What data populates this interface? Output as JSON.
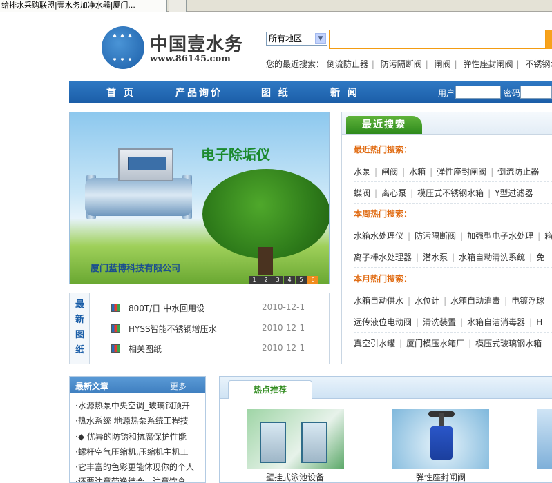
{
  "browser": {
    "tab_title": "给排水采购联盟|壹水务加净水器|厦门..."
  },
  "header": {
    "logo_text": "中国壹水务",
    "logo_url": "www.86145.com",
    "region_select": "所有地区",
    "search_placeholder": "",
    "recent_label": "您的最近搜索：",
    "recent_terms": [
      "倒流防止器",
      "防污隔断阀",
      "闸阀",
      "弹性座封闸阀",
      "不锈钢水箱"
    ]
  },
  "nav": {
    "items": [
      "首 页",
      "产品询价",
      "图 纸",
      "新 闻"
    ],
    "user_label": "用户",
    "password_label": "密码"
  },
  "banner": {
    "title": "电子除垢仪",
    "company": "厦门蓝博科技有限公司",
    "pager": [
      "1",
      "2",
      "3",
      "4",
      "5",
      "6"
    ]
  },
  "drawings": {
    "label_chars": [
      "最",
      "新",
      "图",
      "纸"
    ],
    "rows": [
      {
        "title": "800T/日 中水回用设",
        "date": "2010-12-1"
      },
      {
        "title": "HYSS智能不锈钢增压水",
        "date": "2010-12-1"
      },
      {
        "title": "相关图纸",
        "date": "2010-12-1"
      }
    ]
  },
  "recent_panel": {
    "tab": "最近搜索",
    "sections": [
      {
        "title": "最近热门搜索：",
        "lines": [
          [
            "水泵",
            "闸阀",
            "水箱",
            "弹性座封闸阀",
            "倒流防止器"
          ],
          [
            "蝶阀",
            "离心泵",
            "模压式不锈钢水箱",
            "Y型过滤器"
          ]
        ]
      },
      {
        "title": "本周热门搜索：",
        "lines": [
          [
            "水箱水处理仪",
            "防污隔断阀",
            "加强型电子水处理",
            "箱"
          ],
          [
            "离子棒水处理器",
            "潜水泵",
            "水箱自动清洗系统",
            "免"
          ]
        ]
      },
      {
        "title": "本月热门搜索：",
        "lines": [
          [
            "水箱自动供水",
            "水位计",
            "水箱自动消毒",
            "电镀浮球"
          ],
          [
            "远传液位电动阀",
            "清洗装置",
            "水箱自洁消毒器",
            "H"
          ],
          [
            "真空引水罐",
            "厦门模压水箱厂",
            "模压式玻璃钢水箱"
          ]
        ]
      }
    ]
  },
  "articles": {
    "title": "最新文章",
    "more": "更多",
    "items": [
      "·水源热泵中央空调_玻璃钢顶开",
      "·热水系统 地源热泵系统工程技",
      "·◆ 优异的防锈和抗腐保护性能",
      "·螺杆空气压缩机,压缩机主机工",
      "·它丰富的色彩更能体现你的个人",
      "·还要注意劳逸结合、注意饮食、"
    ]
  },
  "hot": {
    "tab": "热点推荐",
    "products": [
      {
        "caption": "壁挂式泳池设备"
      },
      {
        "caption": "弹性座封闸阀"
      }
    ]
  },
  "colors": {
    "brand_blue": "#1b5ea8",
    "accent_orange": "#f39c12",
    "section_orange": "#e06a10",
    "green": "#2e8a1c"
  }
}
